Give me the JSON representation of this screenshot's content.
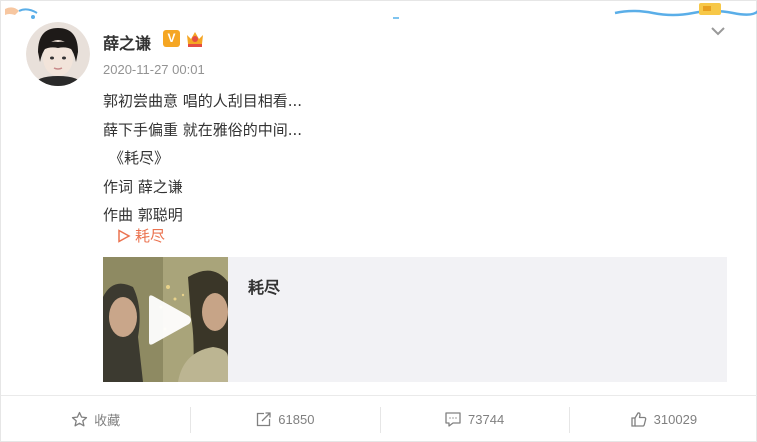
{
  "post": {
    "username": "薛之谦",
    "verified_badge": "V",
    "timestamp": "2020-11-27 00:01",
    "lines": [
      "郭初尝曲意 唱的人刮目相看...",
      "薛下手偏重 就在雅俗的中间...",
      "《耗尽》",
      "作词 薛之谦",
      "作曲 郭聪明"
    ],
    "music_link": "耗尽"
  },
  "music_card": {
    "title": "耗尽"
  },
  "actions": {
    "favorite": "收藏",
    "repost_count": "61850",
    "comment_count": "73744",
    "like_count": "310029"
  },
  "colors": {
    "link": "#eb7350",
    "verified": "#f5a623",
    "timestamp": "#939393",
    "card_bg": "#f2f2f5"
  }
}
